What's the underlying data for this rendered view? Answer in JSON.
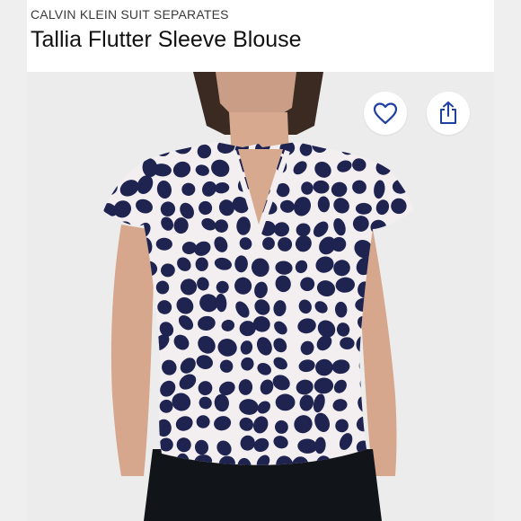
{
  "header": {
    "brand": "CALVIN KLEIN SUIT SEPARATES",
    "title": "Tallia Flutter Sleeve Blouse"
  },
  "actions": {
    "favorite_icon": "heart-outline-icon",
    "share_icon": "share-upload-icon",
    "accent_color": "#1f3fa3"
  },
  "product_image": {
    "print_color": "#1e2350",
    "base_color": "#f3eef0"
  }
}
